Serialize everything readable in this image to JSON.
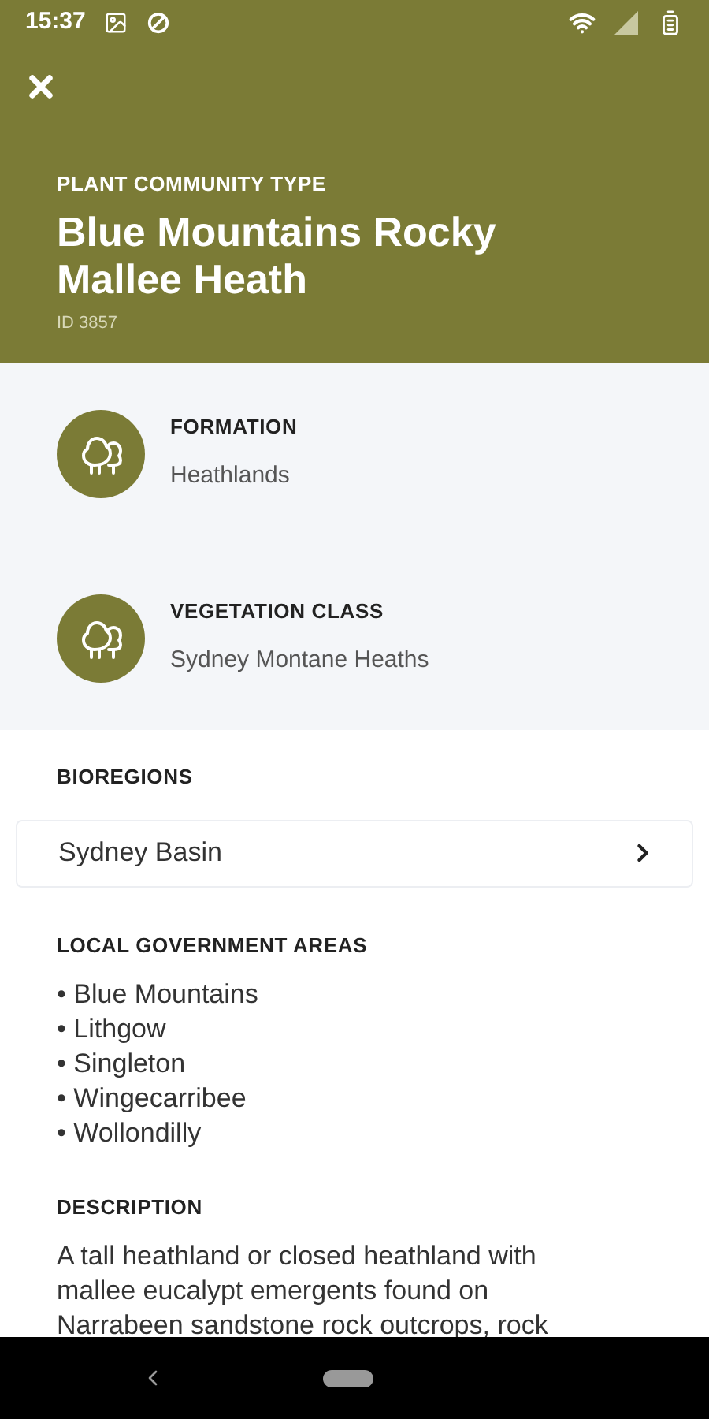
{
  "status_bar": {
    "time": "15:37"
  },
  "header": {
    "eyebrow": "PLANT COMMUNITY TYPE",
    "title": "Blue Mountains Rocky Mallee Heath",
    "id": "ID 3857"
  },
  "classifications": [
    {
      "label": "FORMATION",
      "value": "Heathlands"
    },
    {
      "label": "VEGETATION CLASS",
      "value": "Sydney Montane Heaths"
    }
  ],
  "bioregions": {
    "heading": "BIOREGIONS",
    "items": [
      "Sydney Basin"
    ]
  },
  "local_government_areas": {
    "heading": "LOCAL GOVERNMENT AREAS",
    "items": [
      "• Blue Mountains",
      "• Lithgow",
      "• Singleton",
      "• Wingecarribee",
      "• Wollondilly"
    ]
  },
  "description": {
    "heading": "DESCRIPTION",
    "text": "A tall heathland or closed heathland with mallee eucalypt emergents found on Narrabeen sandstone rock outcrops, rock"
  }
}
